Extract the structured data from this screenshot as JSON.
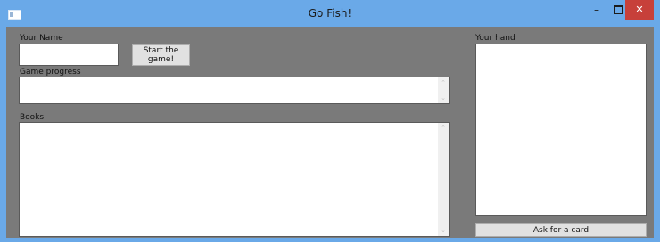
{
  "window": {
    "title": "Go Fish!",
    "minimize_glyph": "–",
    "close_glyph": "✕"
  },
  "player": {
    "name_label": "Your Name",
    "name_value": "",
    "start_button": "Start the game!"
  },
  "progress": {
    "label": "Game progress",
    "text": ""
  },
  "books": {
    "label": "Books",
    "text": ""
  },
  "hand": {
    "label": "Your hand",
    "cards": [],
    "ask_button": "Ask for a card"
  },
  "icons": {
    "scroll_up": "⌃",
    "scroll_down": "⌄"
  },
  "colors": {
    "titlebar": "#6aa9e8",
    "client_background": "#7a7a7a",
    "close_button": "#c7403a"
  }
}
